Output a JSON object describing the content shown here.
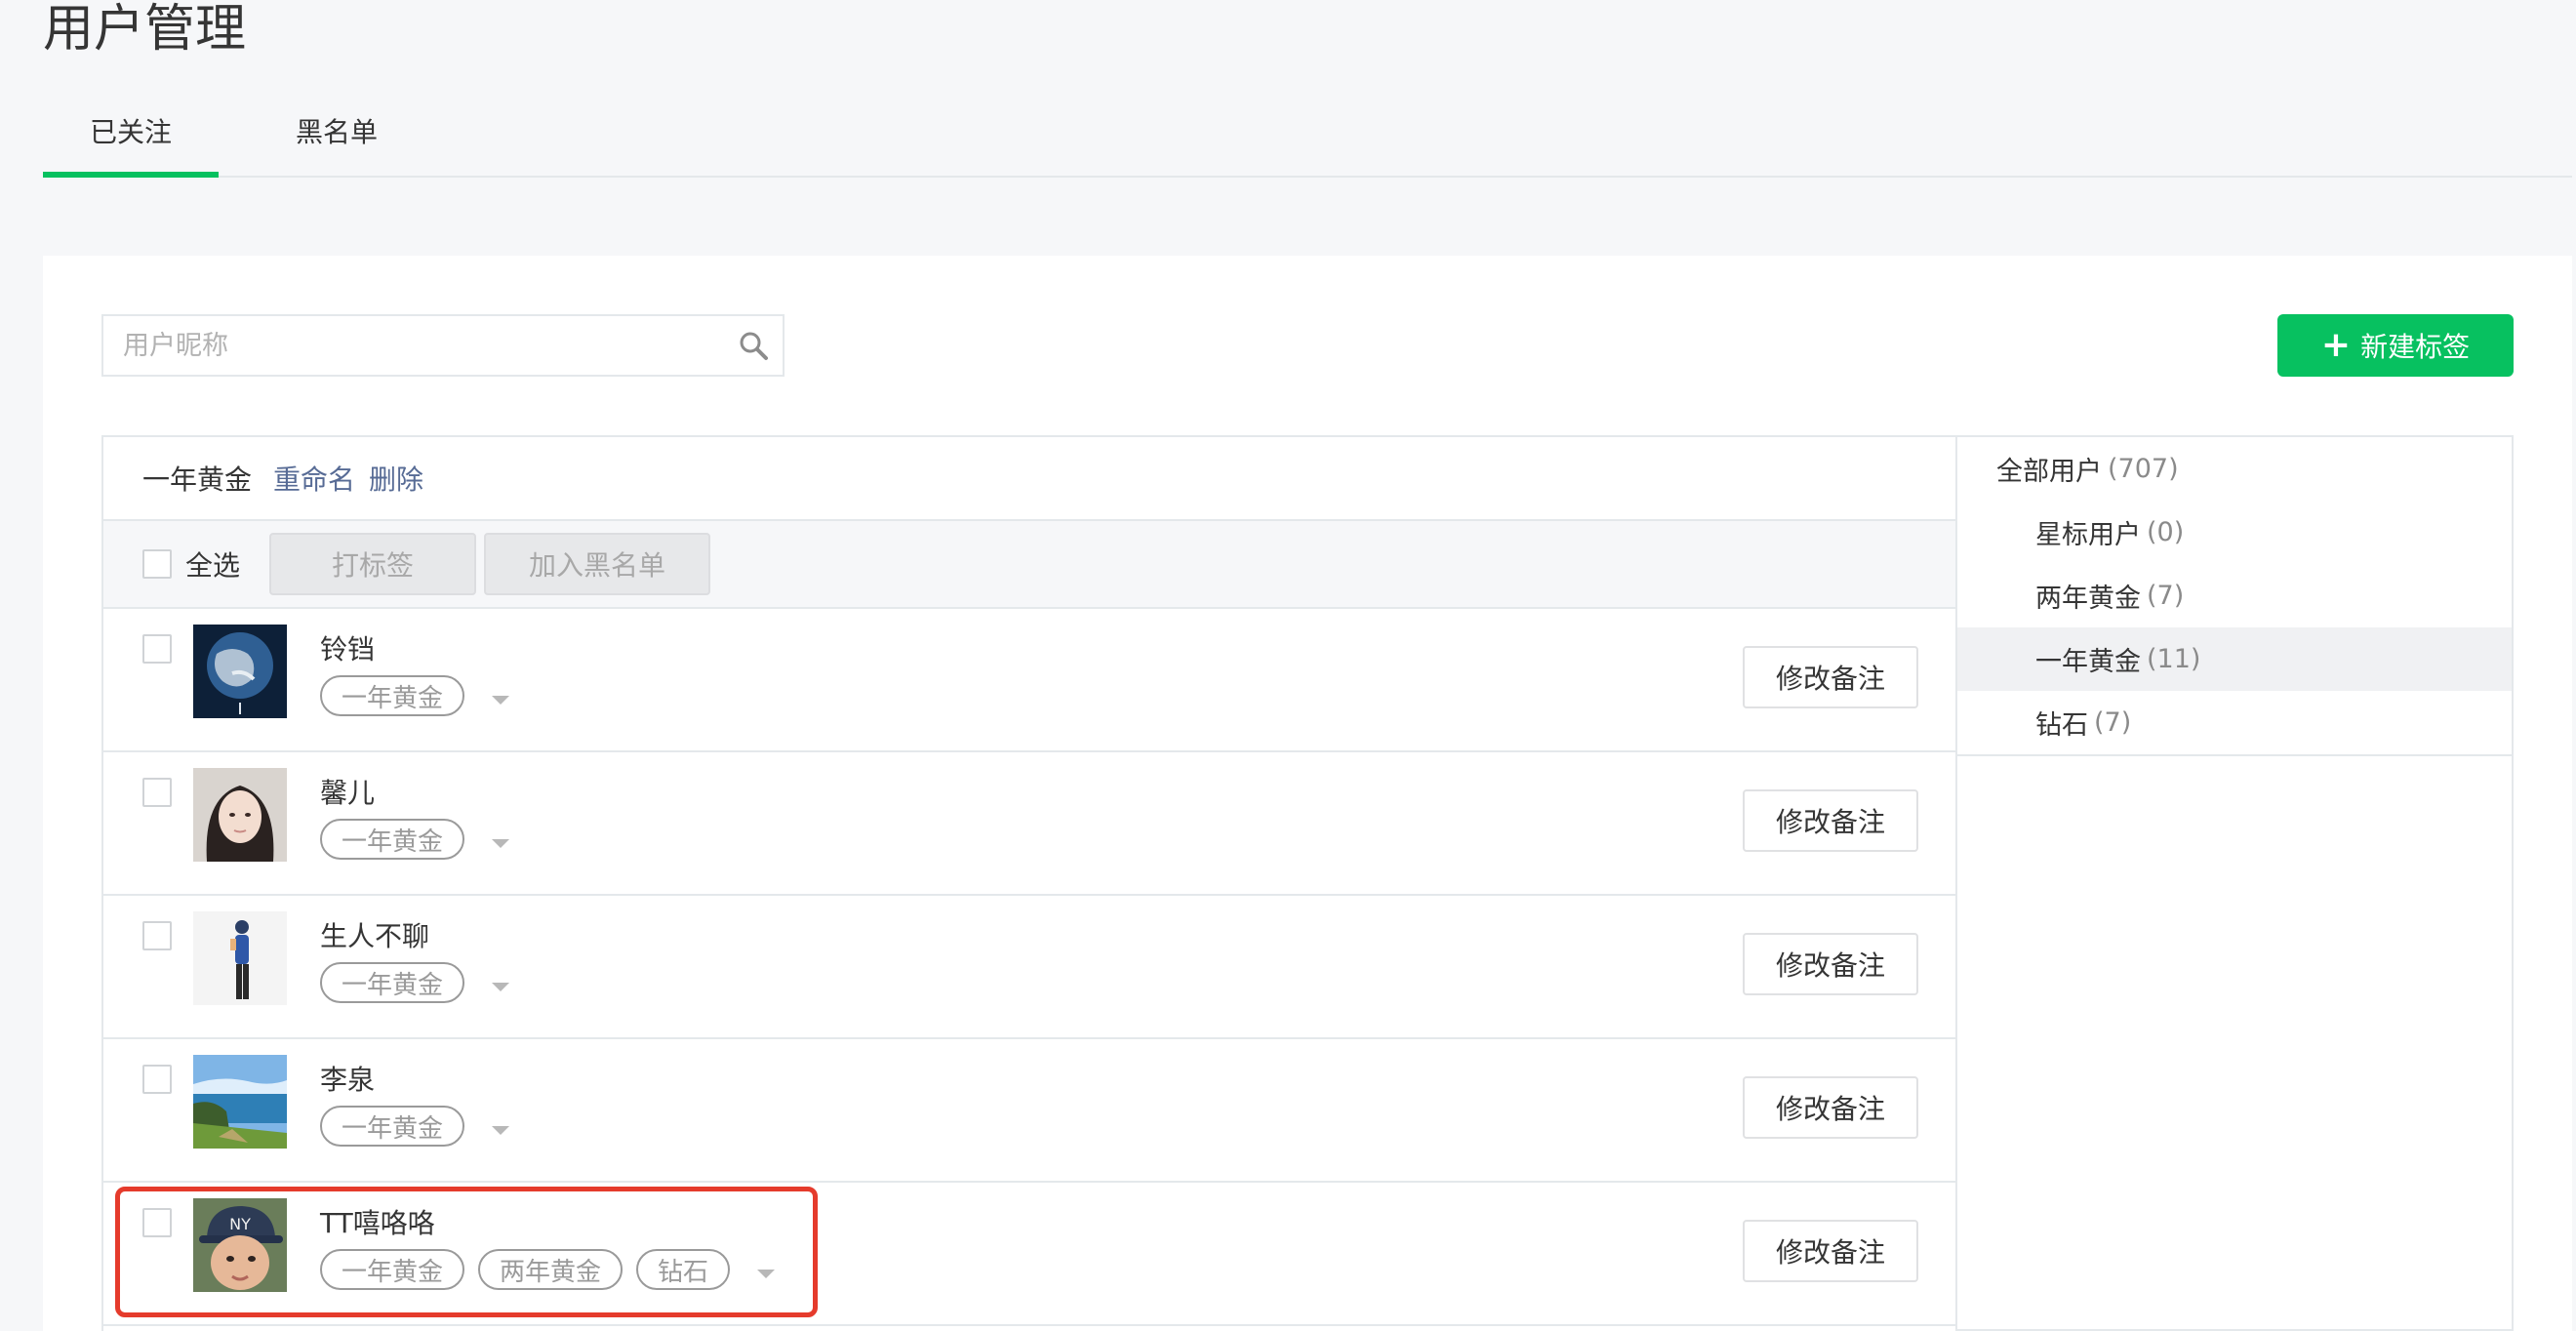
{
  "page": {
    "title": "用户管理"
  },
  "tabs": [
    {
      "label": "已关注",
      "active": true
    },
    {
      "label": "黑名单",
      "active": false
    }
  ],
  "search": {
    "placeholder": "用户昵称",
    "icon": "search-icon"
  },
  "new_tag_button": {
    "icon": "plus-icon",
    "label": "新建标签"
  },
  "group": {
    "name": "一年黄金",
    "rename_label": "重命名",
    "delete_label": "删除"
  },
  "toolbar": {
    "select_all_label": "全选",
    "tag_button": "打标签",
    "blacklist_button": "加入黑名单"
  },
  "users": [
    {
      "name": "铃铛",
      "tags": [
        "一年黄金"
      ],
      "remark_button": "修改备注"
    },
    {
      "name": "馨儿",
      "tags": [
        "一年黄金"
      ],
      "remark_button": "修改备注"
    },
    {
      "name": "生人不聊",
      "tags": [
        "一年黄金"
      ],
      "remark_button": "修改备注"
    },
    {
      "name": "李泉",
      "tags": [
        "一年黄金"
      ],
      "remark_button": "修改备注"
    },
    {
      "name": "TT嘻咯咯",
      "tags": [
        "一年黄金",
        "两年黄金",
        "钻石"
      ],
      "remark_button": "修改备注"
    }
  ],
  "sidebar": {
    "all": {
      "label": "全部用户",
      "count": "(707)"
    },
    "items": [
      {
        "label": "星标用户",
        "count": "(0)"
      },
      {
        "label": "两年黄金",
        "count": "(7)"
      },
      {
        "label": "一年黄金",
        "count": "(11)",
        "active": true
      },
      {
        "label": "钻石",
        "count": "(7)"
      }
    ]
  },
  "colors": {
    "accent": "#07c160",
    "link": "#576b95",
    "highlight": "#e53b2c"
  }
}
